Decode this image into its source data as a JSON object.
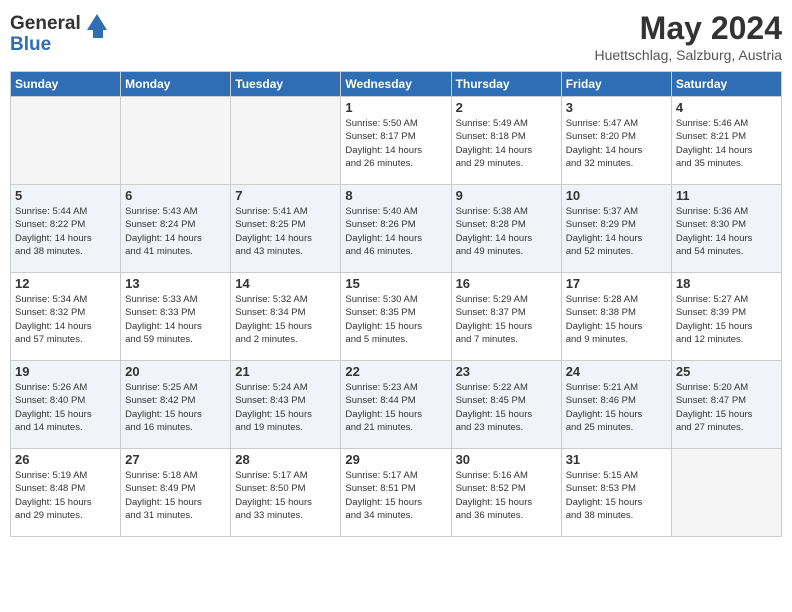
{
  "header": {
    "logo_line1": "General",
    "logo_line2": "Blue",
    "month_year": "May 2024",
    "location": "Huettschlag, Salzburg, Austria"
  },
  "days_of_week": [
    "Sunday",
    "Monday",
    "Tuesday",
    "Wednesday",
    "Thursday",
    "Friday",
    "Saturday"
  ],
  "weeks": [
    [
      {
        "day": "",
        "info": ""
      },
      {
        "day": "",
        "info": ""
      },
      {
        "day": "",
        "info": ""
      },
      {
        "day": "1",
        "info": "Sunrise: 5:50 AM\nSunset: 8:17 PM\nDaylight: 14 hours\nand 26 minutes."
      },
      {
        "day": "2",
        "info": "Sunrise: 5:49 AM\nSunset: 8:18 PM\nDaylight: 14 hours\nand 29 minutes."
      },
      {
        "day": "3",
        "info": "Sunrise: 5:47 AM\nSunset: 8:20 PM\nDaylight: 14 hours\nand 32 minutes."
      },
      {
        "day": "4",
        "info": "Sunrise: 5:46 AM\nSunset: 8:21 PM\nDaylight: 14 hours\nand 35 minutes."
      }
    ],
    [
      {
        "day": "5",
        "info": "Sunrise: 5:44 AM\nSunset: 8:22 PM\nDaylight: 14 hours\nand 38 minutes."
      },
      {
        "day": "6",
        "info": "Sunrise: 5:43 AM\nSunset: 8:24 PM\nDaylight: 14 hours\nand 41 minutes."
      },
      {
        "day": "7",
        "info": "Sunrise: 5:41 AM\nSunset: 8:25 PM\nDaylight: 14 hours\nand 43 minutes."
      },
      {
        "day": "8",
        "info": "Sunrise: 5:40 AM\nSunset: 8:26 PM\nDaylight: 14 hours\nand 46 minutes."
      },
      {
        "day": "9",
        "info": "Sunrise: 5:38 AM\nSunset: 8:28 PM\nDaylight: 14 hours\nand 49 minutes."
      },
      {
        "day": "10",
        "info": "Sunrise: 5:37 AM\nSunset: 8:29 PM\nDaylight: 14 hours\nand 52 minutes."
      },
      {
        "day": "11",
        "info": "Sunrise: 5:36 AM\nSunset: 8:30 PM\nDaylight: 14 hours\nand 54 minutes."
      }
    ],
    [
      {
        "day": "12",
        "info": "Sunrise: 5:34 AM\nSunset: 8:32 PM\nDaylight: 14 hours\nand 57 minutes."
      },
      {
        "day": "13",
        "info": "Sunrise: 5:33 AM\nSunset: 8:33 PM\nDaylight: 14 hours\nand 59 minutes."
      },
      {
        "day": "14",
        "info": "Sunrise: 5:32 AM\nSunset: 8:34 PM\nDaylight: 15 hours\nand 2 minutes."
      },
      {
        "day": "15",
        "info": "Sunrise: 5:30 AM\nSunset: 8:35 PM\nDaylight: 15 hours\nand 5 minutes."
      },
      {
        "day": "16",
        "info": "Sunrise: 5:29 AM\nSunset: 8:37 PM\nDaylight: 15 hours\nand 7 minutes."
      },
      {
        "day": "17",
        "info": "Sunrise: 5:28 AM\nSunset: 8:38 PM\nDaylight: 15 hours\nand 9 minutes."
      },
      {
        "day": "18",
        "info": "Sunrise: 5:27 AM\nSunset: 8:39 PM\nDaylight: 15 hours\nand 12 minutes."
      }
    ],
    [
      {
        "day": "19",
        "info": "Sunrise: 5:26 AM\nSunset: 8:40 PM\nDaylight: 15 hours\nand 14 minutes."
      },
      {
        "day": "20",
        "info": "Sunrise: 5:25 AM\nSunset: 8:42 PM\nDaylight: 15 hours\nand 16 minutes."
      },
      {
        "day": "21",
        "info": "Sunrise: 5:24 AM\nSunset: 8:43 PM\nDaylight: 15 hours\nand 19 minutes."
      },
      {
        "day": "22",
        "info": "Sunrise: 5:23 AM\nSunset: 8:44 PM\nDaylight: 15 hours\nand 21 minutes."
      },
      {
        "day": "23",
        "info": "Sunrise: 5:22 AM\nSunset: 8:45 PM\nDaylight: 15 hours\nand 23 minutes."
      },
      {
        "day": "24",
        "info": "Sunrise: 5:21 AM\nSunset: 8:46 PM\nDaylight: 15 hours\nand 25 minutes."
      },
      {
        "day": "25",
        "info": "Sunrise: 5:20 AM\nSunset: 8:47 PM\nDaylight: 15 hours\nand 27 minutes."
      }
    ],
    [
      {
        "day": "26",
        "info": "Sunrise: 5:19 AM\nSunset: 8:48 PM\nDaylight: 15 hours\nand 29 minutes."
      },
      {
        "day": "27",
        "info": "Sunrise: 5:18 AM\nSunset: 8:49 PM\nDaylight: 15 hours\nand 31 minutes."
      },
      {
        "day": "28",
        "info": "Sunrise: 5:17 AM\nSunset: 8:50 PM\nDaylight: 15 hours\nand 33 minutes."
      },
      {
        "day": "29",
        "info": "Sunrise: 5:17 AM\nSunset: 8:51 PM\nDaylight: 15 hours\nand 34 minutes."
      },
      {
        "day": "30",
        "info": "Sunrise: 5:16 AM\nSunset: 8:52 PM\nDaylight: 15 hours\nand 36 minutes."
      },
      {
        "day": "31",
        "info": "Sunrise: 5:15 AM\nSunset: 8:53 PM\nDaylight: 15 hours\nand 38 minutes."
      },
      {
        "day": "",
        "info": ""
      }
    ]
  ]
}
